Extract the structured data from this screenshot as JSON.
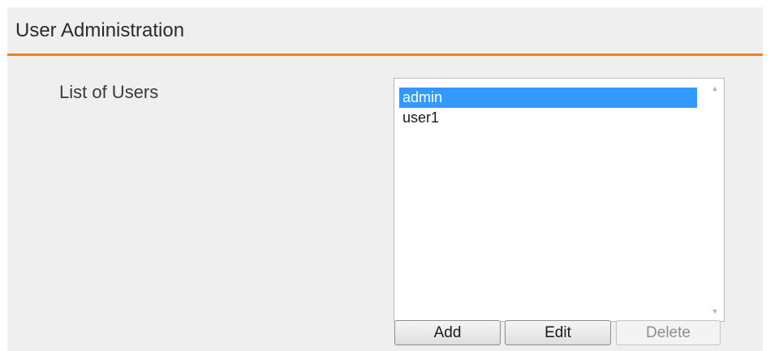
{
  "panel": {
    "title": "User Administration",
    "accent_color": "#f0821e"
  },
  "users_field": {
    "label": "List of Users",
    "items": [
      "admin",
      "user1"
    ],
    "selected_item": "admin",
    "selection_color": "#3399ff"
  },
  "buttons": {
    "add_label": "Add",
    "edit_label": "Edit",
    "delete_label": "Delete",
    "delete_enabled": false
  },
  "icons": {
    "scroll_up": "scroll-up-arrow",
    "scroll_down": "scroll-down-arrow"
  }
}
